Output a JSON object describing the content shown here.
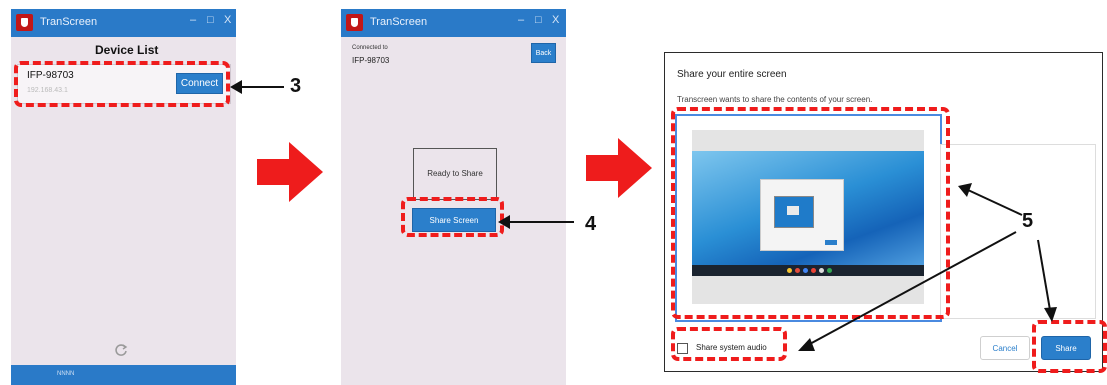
{
  "panel1": {
    "app_title": "TranScreen",
    "window_controls": [
      "–",
      "□",
      "X"
    ],
    "heading": "Device List",
    "device_name": "IFP-98703",
    "device_ip": "192.168.43.1",
    "connect_label": "Connect",
    "footer_text": "NNNN"
  },
  "panel2": {
    "app_title": "TranScreen",
    "window_controls": [
      "–",
      "□",
      "X"
    ],
    "connected_caption": "Connected to",
    "device_name": "IFP-98703",
    "back_label": "Back",
    "ready_label": "Ready to Share",
    "share_screen_label": "Share Screen"
  },
  "dialog": {
    "title": "Share your entire screen",
    "subtitle": "Transcreen wants to share the contents of your screen.",
    "audio_label": "Share system audio",
    "cancel_label": "Cancel",
    "share_label": "Share"
  },
  "callouts": [
    "3",
    "4",
    "5"
  ],
  "colors": {
    "accent_blue": "#2b7fcb",
    "titlebar_blue": "#2a7ac8",
    "arrow_red": "#ee1c1c",
    "highlight_red": "#ef1c1c",
    "panel_bg": "#ebe4eb"
  }
}
